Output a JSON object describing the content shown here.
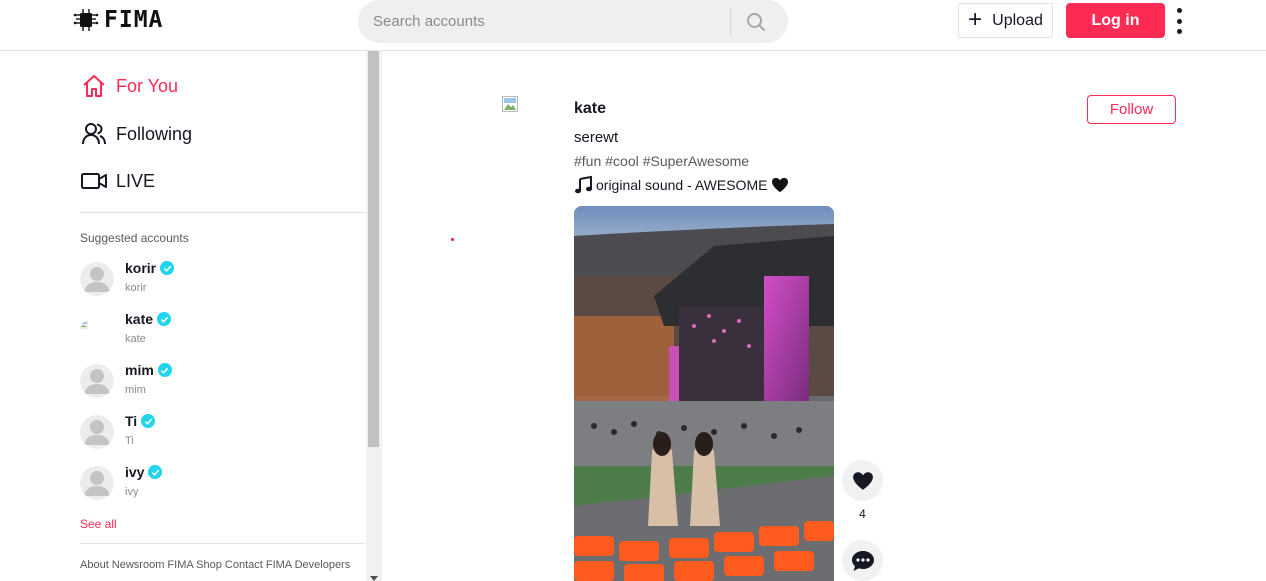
{
  "app": {
    "name": "FIMA"
  },
  "header": {
    "search_placeholder": "Search accounts",
    "upload_label": "Upload",
    "login_label": "Log in"
  },
  "sidebar": {
    "nav": [
      {
        "label": "For You",
        "icon": "home-icon",
        "active": true
      },
      {
        "label": "Following",
        "icon": "people-icon",
        "active": false
      },
      {
        "label": "LIVE",
        "icon": "live-video-icon",
        "active": false
      }
    ],
    "suggested_title": "Suggested accounts",
    "accounts": [
      {
        "username": "korir",
        "nickname": "korir",
        "verified": true,
        "avatar": "default-avatar-icon"
      },
      {
        "username": "kate",
        "nickname": "kate",
        "verified": true,
        "avatar": "broken-image-icon"
      },
      {
        "username": "mim",
        "nickname": "mim",
        "verified": true,
        "avatar": "default-avatar-icon"
      },
      {
        "username": "Ti",
        "nickname": "Ti",
        "verified": true,
        "avatar": "default-avatar-icon"
      },
      {
        "username": "ivy",
        "nickname": "ivy",
        "verified": true,
        "avatar": "default-avatar-icon"
      }
    ],
    "see_all": "See all",
    "footer": "About Newsroom FIMA Shop Contact FIMA Developers"
  },
  "feed": {
    "post": {
      "author": "kate",
      "follow_label": "Follow",
      "caption": "serewt",
      "hashtags": [
        "#fun",
        "#cool",
        "#SuperAwesome"
      ],
      "sound": "original sound - AWESOME",
      "likes": "4"
    }
  },
  "colors": {
    "accent": "#fe2c55",
    "verified": "#20d5ec",
    "text": "#161823",
    "muted": "#8a8b91"
  }
}
